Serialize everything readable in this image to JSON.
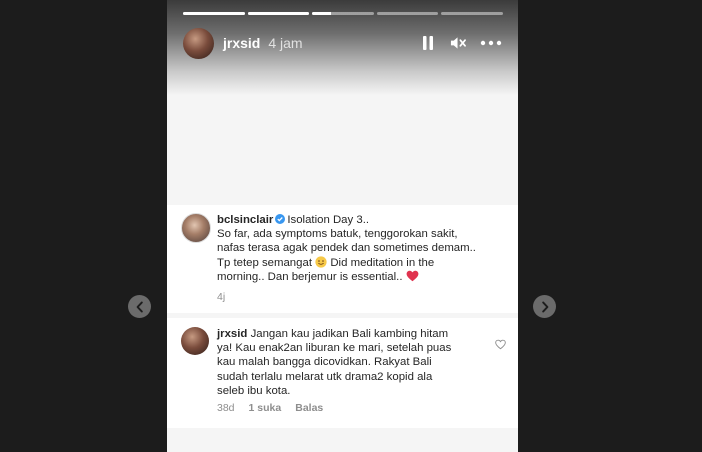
{
  "story": {
    "progress": [
      1,
      1,
      0.3,
      0,
      0
    ],
    "username": "jrxsid",
    "time": "4 jam"
  },
  "post_caption": {
    "username": "bclsinclair",
    "text_line1": "Isolation Day 3..",
    "text_line2": "So far, ada symptoms batuk, tenggorokan sakit,",
    "text_line3": "nafas terasa agak pendek dan sometimes demam..",
    "text_line4a": "Tp tetep semangat",
    "text_line4b": "Did meditation in the",
    "text_line5": "morning.. Dan berjemur is essential..",
    "age": "4j"
  },
  "comment": {
    "username": "jrxsid",
    "line1": "Jangan kau jadikan Bali kambing hitam",
    "line2": "ya! Kau enak2an liburan ke mari, setelah puas",
    "line3": "kau malah bangga dicovidkan. Rakyat Bali",
    "line4": "sudah terlalu melarat utk drama2 kopid ala",
    "line5": "seleb ibu kota.",
    "age": "38d",
    "likes": "1 suka",
    "reply_label": "Balas"
  },
  "icons": {
    "pause": "pause-icon",
    "mute": "muted-speaker-icon",
    "more": "more-horizontal-icon",
    "verified": "verified-badge-icon",
    "heart": "heart-outline-icon",
    "prev": "chevron-left-icon",
    "next": "chevron-right-icon"
  },
  "colors": {
    "verified_blue": "#3897f0",
    "heart_red": "#e0334f",
    "muted_text": "#8e8e8e"
  }
}
